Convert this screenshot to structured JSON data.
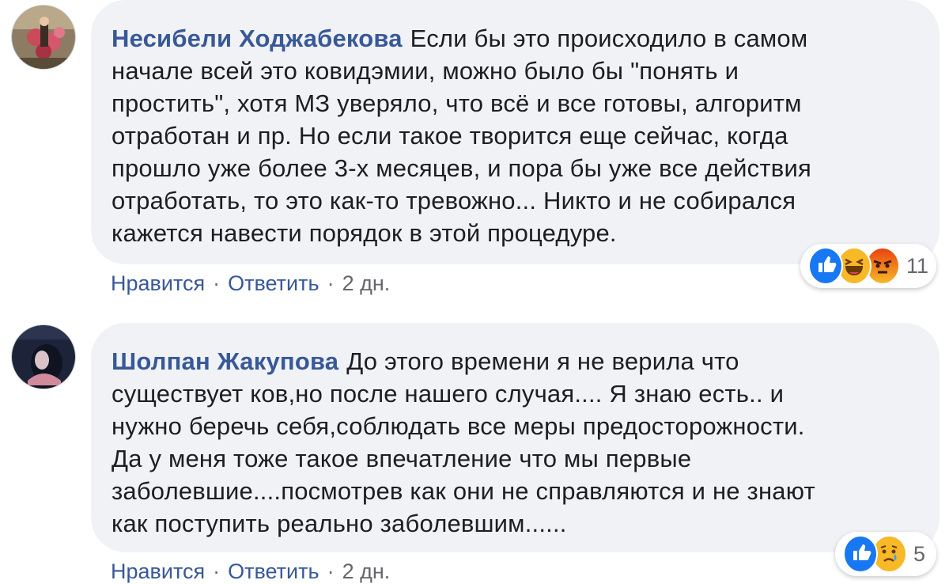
{
  "comments": [
    {
      "author": "Несибели Ходжабекова",
      "text": "Если бы это происходило в самом\nначале всей это ковидэмии, можно было бы \"понять и\nпростить\", хотя МЗ уверяло, что всё и все готовы, алгоритм\nотработан и пр. Но если такое творится еще сейчас, когда\nпрошло уже более 3-х месяцев, и пора бы уже все действия\nотработать, то это как-то тревожно... Никто и не собирался\nкажется навести порядок в этой процедуре.",
      "like_label": "Нравится",
      "reply_label": "Ответить",
      "time": "2 дн.",
      "reactions": [
        "like-icon",
        "haha-icon",
        "angry-icon"
      ],
      "reaction_count": "11"
    },
    {
      "author": "Шолпан Жакупова",
      "text": "До этого времени я не верила что\nсуществует ков,но после нашего случая.... Я знаю есть.. и\nнужно беречь себя,соблюдать все меры предосторожности.\nДа у меня тоже такое впечатление что мы первые\nзаболевшие....посмотрев как они не справляются и не знают\nкак поступить реально заболевшим......",
      "like_label": "Нравится",
      "reply_label": "Ответить",
      "time": "2 дн.",
      "reactions": [
        "like-icon",
        "sad-icon"
      ],
      "reaction_count": "5"
    }
  ],
  "separator": "·",
  "colors": {
    "author": "#385898",
    "bubble": "#f0f2f5",
    "meta": "#65676b",
    "like": "#1877f2",
    "haha": "#f7b928",
    "angry": "#e9710f"
  }
}
